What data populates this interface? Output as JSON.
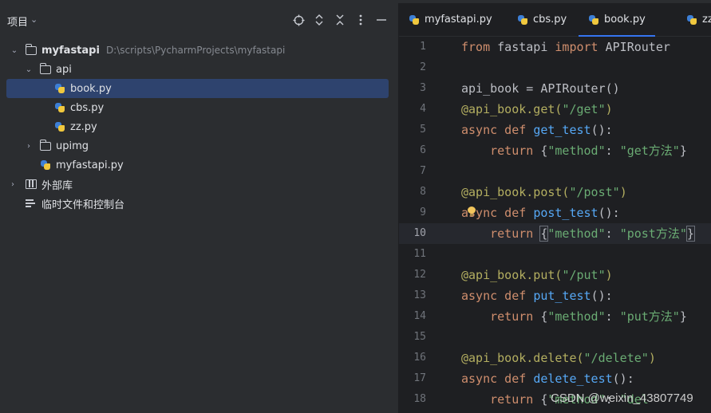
{
  "project_panel": {
    "title": "项目",
    "root": {
      "name": "myfastapi",
      "path": "D:\\scripts\\PycharmProjects\\myfastapi"
    },
    "tree": [
      {
        "label": "api"
      },
      {
        "label": "book.py"
      },
      {
        "label": "cbs.py"
      },
      {
        "label": "zz.py"
      },
      {
        "label": "upimg"
      },
      {
        "label": "myfastapi.py"
      },
      {
        "label": "外部库"
      },
      {
        "label": "临时文件和控制台"
      }
    ]
  },
  "tabs": [
    {
      "label": "myfastapi.py"
    },
    {
      "label": "cbs.py"
    },
    {
      "label": "book.py",
      "active": true
    },
    {
      "label": "zz"
    }
  ],
  "editor": {
    "current_line": 10,
    "lines": [
      {
        "n": "1"
      },
      {
        "n": "2"
      },
      {
        "n": "3"
      },
      {
        "n": "4"
      },
      {
        "n": "5"
      },
      {
        "n": "6"
      },
      {
        "n": "7"
      },
      {
        "n": "8"
      },
      {
        "n": "9"
      },
      {
        "n": "10"
      },
      {
        "n": "11"
      },
      {
        "n": "12"
      },
      {
        "n": "13"
      },
      {
        "n": "14"
      },
      {
        "n": "15"
      },
      {
        "n": "16"
      },
      {
        "n": "17"
      },
      {
        "n": "18"
      }
    ],
    "code": {
      "l1": [
        "from",
        " fastapi ",
        "import",
        " APIRouter"
      ],
      "l3": [
        "api_book = APIRouter()"
      ],
      "l4": [
        "@api_book.get(",
        "\"/get\"",
        ")"
      ],
      "l5": [
        "async def ",
        "get_test",
        "():"
      ],
      "l6": [
        "    return ",
        "{",
        "\"method\"",
        ": ",
        "\"get方法\"",
        "}"
      ],
      "l8": [
        "@api_book.post(",
        "\"/post\"",
        ")"
      ],
      "l9": [
        "async def ",
        "post_test",
        "():"
      ],
      "l10": [
        "    return ",
        "{",
        "\"method\"",
        ": ",
        "\"post方法\"",
        "}"
      ],
      "l12": [
        "@api_book.put(",
        "\"/put\"",
        ")"
      ],
      "l13": [
        "async def ",
        "put_test",
        "():"
      ],
      "l14": [
        "    return ",
        "{",
        "\"method\"",
        ": ",
        "\"put方法\"",
        "}"
      ],
      "l16": [
        "@api_book.delete(",
        "\"/delete\"",
        ")"
      ],
      "l17": [
        "async def ",
        "delete_test",
        "():"
      ],
      "l18": [
        "    return ",
        "{",
        "\"method\"",
        ": ",
        "\"del"
      ]
    }
  },
  "watermark": "CSDN @weixin_43807749",
  "colors": {
    "keyword": "#cf8e6d",
    "function": "#56a8f5",
    "string": "#6aab73",
    "decorator": "#b3ae60",
    "selection": "#2e436e",
    "accent": "#3574f0"
  }
}
